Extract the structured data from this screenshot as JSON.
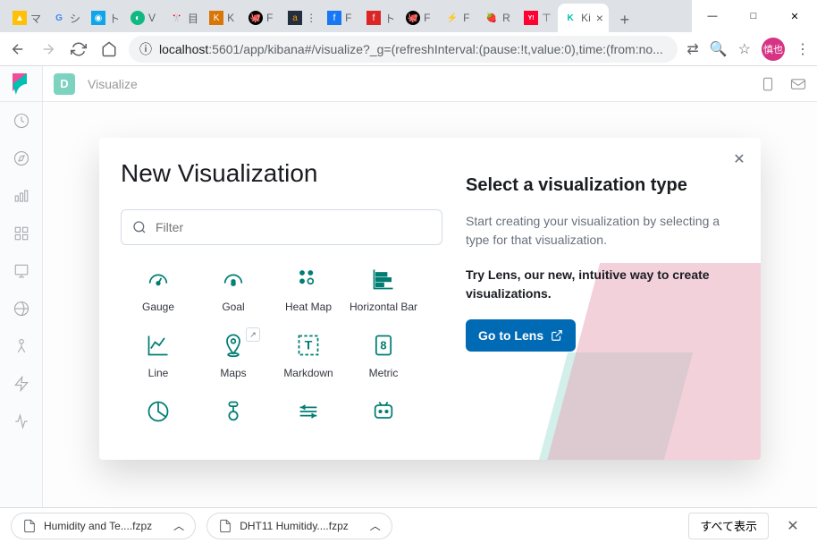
{
  "window": {
    "minimize": "—",
    "maximize": "□",
    "close": "✕"
  },
  "tabs": [
    {
      "fav": "▲",
      "label": "マ"
    },
    {
      "fav": "G",
      "label": "シ"
    },
    {
      "fav": "◉",
      "label": "ト"
    },
    {
      "fav": "◐",
      "label": "V"
    },
    {
      "fav": "🎌",
      "label": "目"
    },
    {
      "fav": "📕",
      "label": "K"
    },
    {
      "fav": "🐙",
      "label": "F"
    },
    {
      "fav": "a",
      "label": "⋮"
    },
    {
      "fav": "📘",
      "label": "F"
    },
    {
      "fav": "f",
      "label": "ト"
    },
    {
      "fav": "🐙",
      "label": "F"
    },
    {
      "fav": "⚡",
      "label": "F"
    },
    {
      "fav": "🍓",
      "label": "R"
    },
    {
      "fav": "Y!",
      "label": "⊤"
    },
    {
      "fav": "K",
      "label": "Ki",
      "active": true
    }
  ],
  "addr": {
    "back": "←",
    "forward": "→",
    "reload": "↻",
    "home": "⌂",
    "info": "ⓘ",
    "host": "localhost",
    "url": ":5601/app/kibana#/visualize?_g=(refreshInterval:(pause:!t,value:0),time:(from:no...",
    "translate": "⟲",
    "zoom": "🔍",
    "star": "☆",
    "avatar": "慎也",
    "menu": "⋮"
  },
  "topbar": {
    "space": "D",
    "crumb": "Visualize",
    "share": "⎘",
    "mail": "✉"
  },
  "modal": {
    "title": "New Visualization",
    "close": "✕",
    "filter_placeholder": "Filter",
    "right_title": "Select a visualization type",
    "right_text": "Start creating your visualization by selecting a type for that visualization.",
    "right_bold": "Try Lens, our new, intuitive way to create visualizations.",
    "lens_label": "Go to Lens",
    "popout": "↗"
  },
  "viz": [
    {
      "label": "Gauge"
    },
    {
      "label": "Goal"
    },
    {
      "label": "Heat Map"
    },
    {
      "label": "Horizontal Bar"
    },
    {
      "label": "Line"
    },
    {
      "label": "Maps",
      "popout": true
    },
    {
      "label": "Markdown"
    },
    {
      "label": "Metric"
    },
    {
      "label": ""
    },
    {
      "label": ""
    },
    {
      "label": ""
    },
    {
      "label": ""
    }
  ],
  "downloads": {
    "item1": "Humidity and Te....fzpz",
    "item2": "DHT11 Humitidy....fzpz",
    "all": "すべて表示",
    "chevron": "︿",
    "close": "✕"
  }
}
